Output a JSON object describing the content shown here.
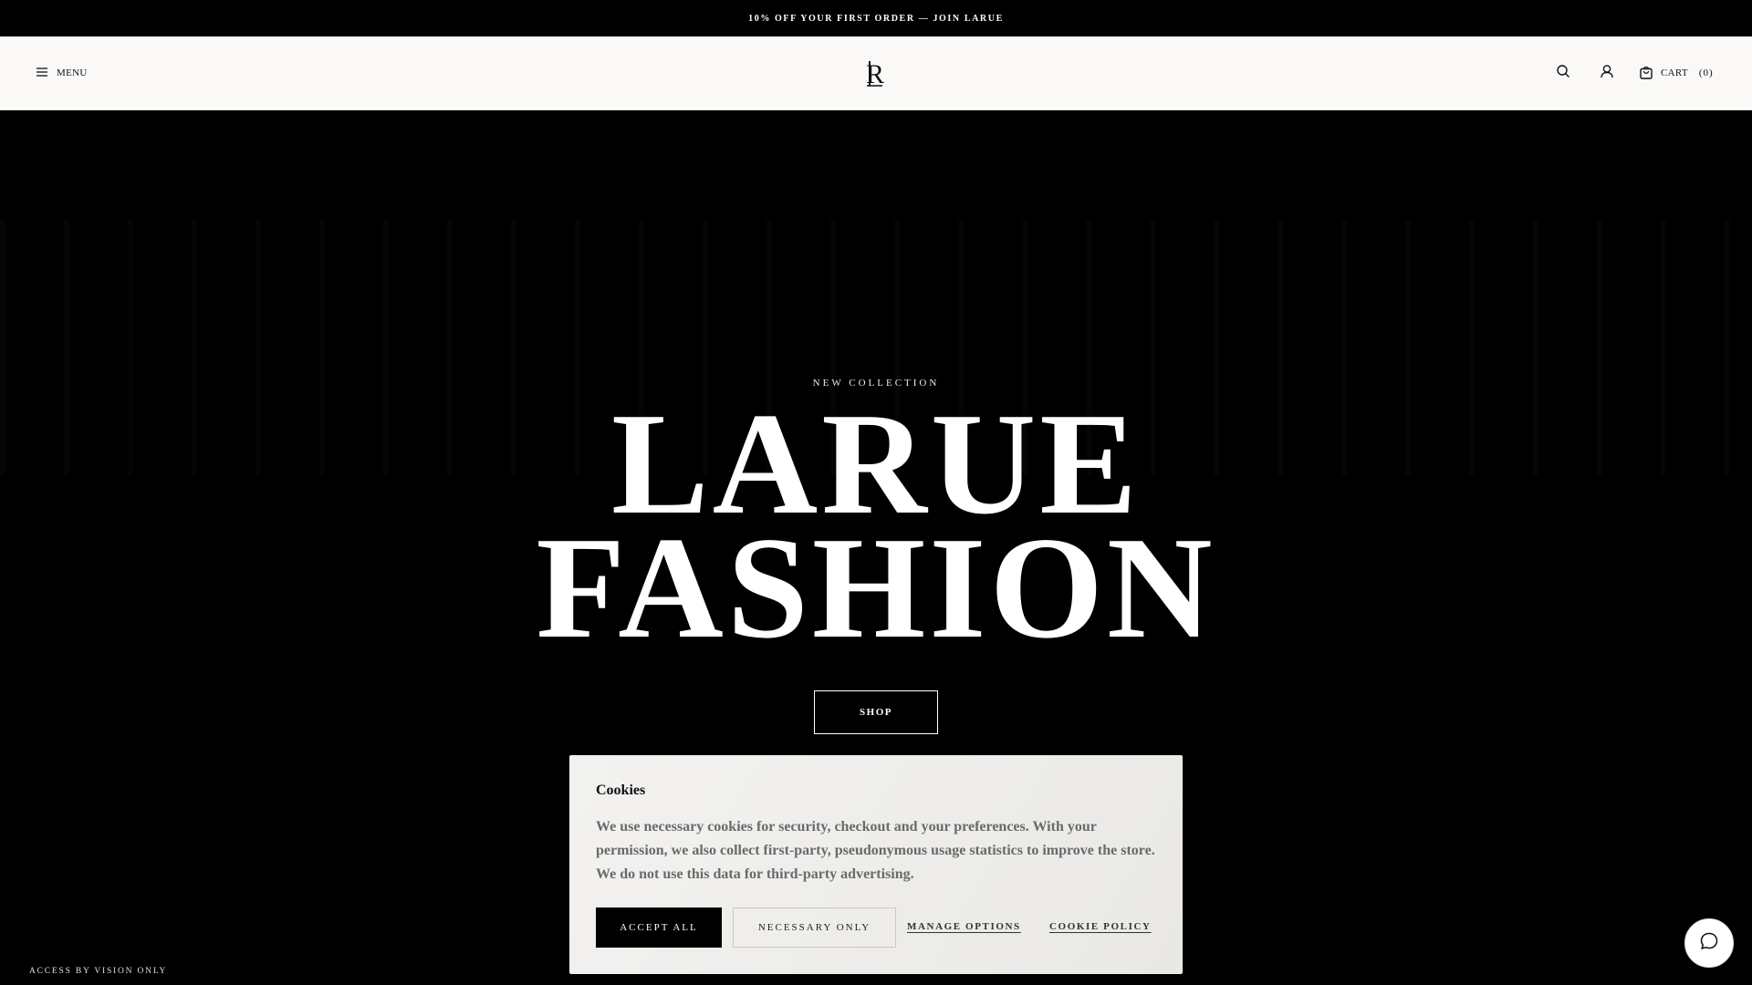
{
  "announcement": {
    "text": "10% OFF YOUR FIRST ORDER — JOIN LARUE"
  },
  "header": {
    "menu_label": "MENU",
    "logo_letters": "R",
    "search_icon": "search-icon",
    "account_icon": "user-icon",
    "cart_label": "CART",
    "cart_count": "(0)"
  },
  "hero": {
    "eyebrow": "NEW COLLECTION",
    "headline_line1": "LARUE",
    "headline_line2": "FASHION",
    "cta": "SHOP"
  },
  "footer": {
    "access_note": "ACCESS BY VISION ONLY"
  },
  "cookie": {
    "title": "Cookies",
    "body": "We use necessary cookies for security, checkout and your preferences. With your permission, we also collect first-party, pseudonymous usage statistics to improve the store. We do not use this data for third-party advertising.",
    "accept_all": "ACCEPT ALL",
    "necessary_only": "NECESSARY ONLY",
    "manage_options": "MANAGE OPTIONS",
    "cookie_policy": "COOKIE POLICY"
  },
  "chat": {
    "icon": "chat-bubble-icon"
  },
  "colors": {
    "background": "#000000",
    "header_bg": "#faf9f7",
    "cookie_bg": "#efeeeb",
    "text_light": "#ffffff",
    "text_muted": "#6a6a6a"
  }
}
